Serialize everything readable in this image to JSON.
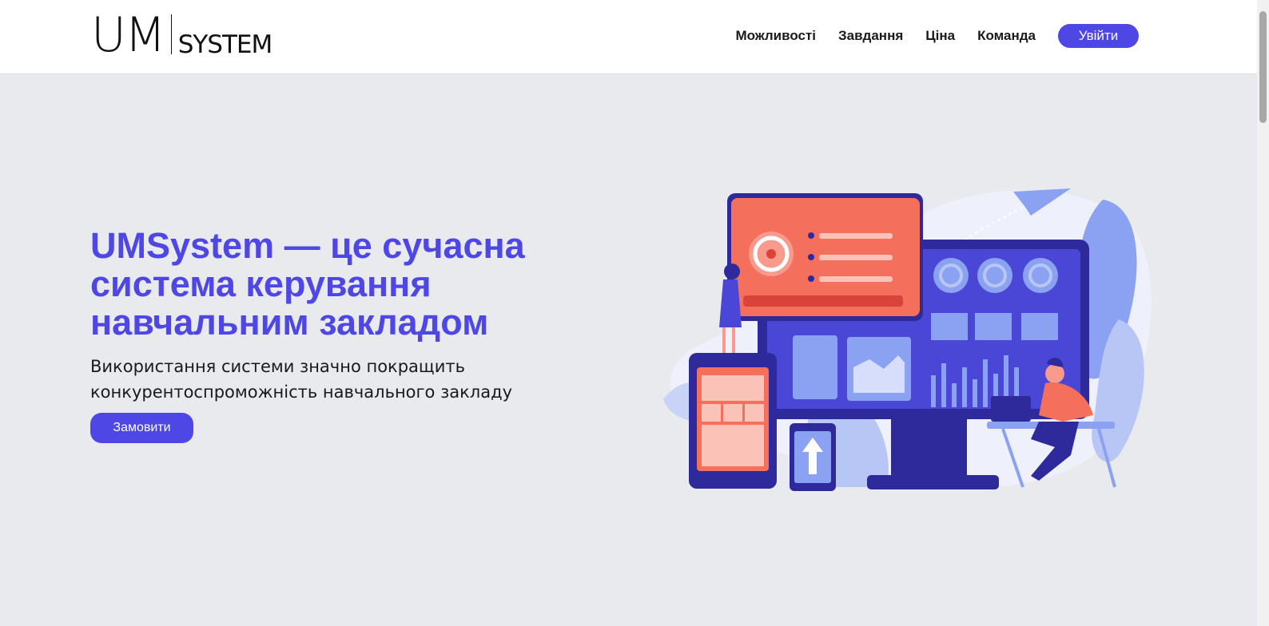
{
  "brand": {
    "logo_main": "UM",
    "logo_sub": "SYSTEM"
  },
  "nav": {
    "items": [
      "Можливості",
      "Завдання",
      "Ціна",
      "Команда"
    ],
    "login_label": "Увійти"
  },
  "hero": {
    "title": "UMSystem — це сучасна система керування навчальним закладом",
    "subtitle": "Використання системи значно покращить конкурентоспроможність навчального закладу",
    "cta_label": "Замовити"
  },
  "colors": {
    "accent": "#4f47e5",
    "background": "#e9eaee",
    "illustration_coral": "#f4705d",
    "illustration_navy": "#3c37b3"
  }
}
